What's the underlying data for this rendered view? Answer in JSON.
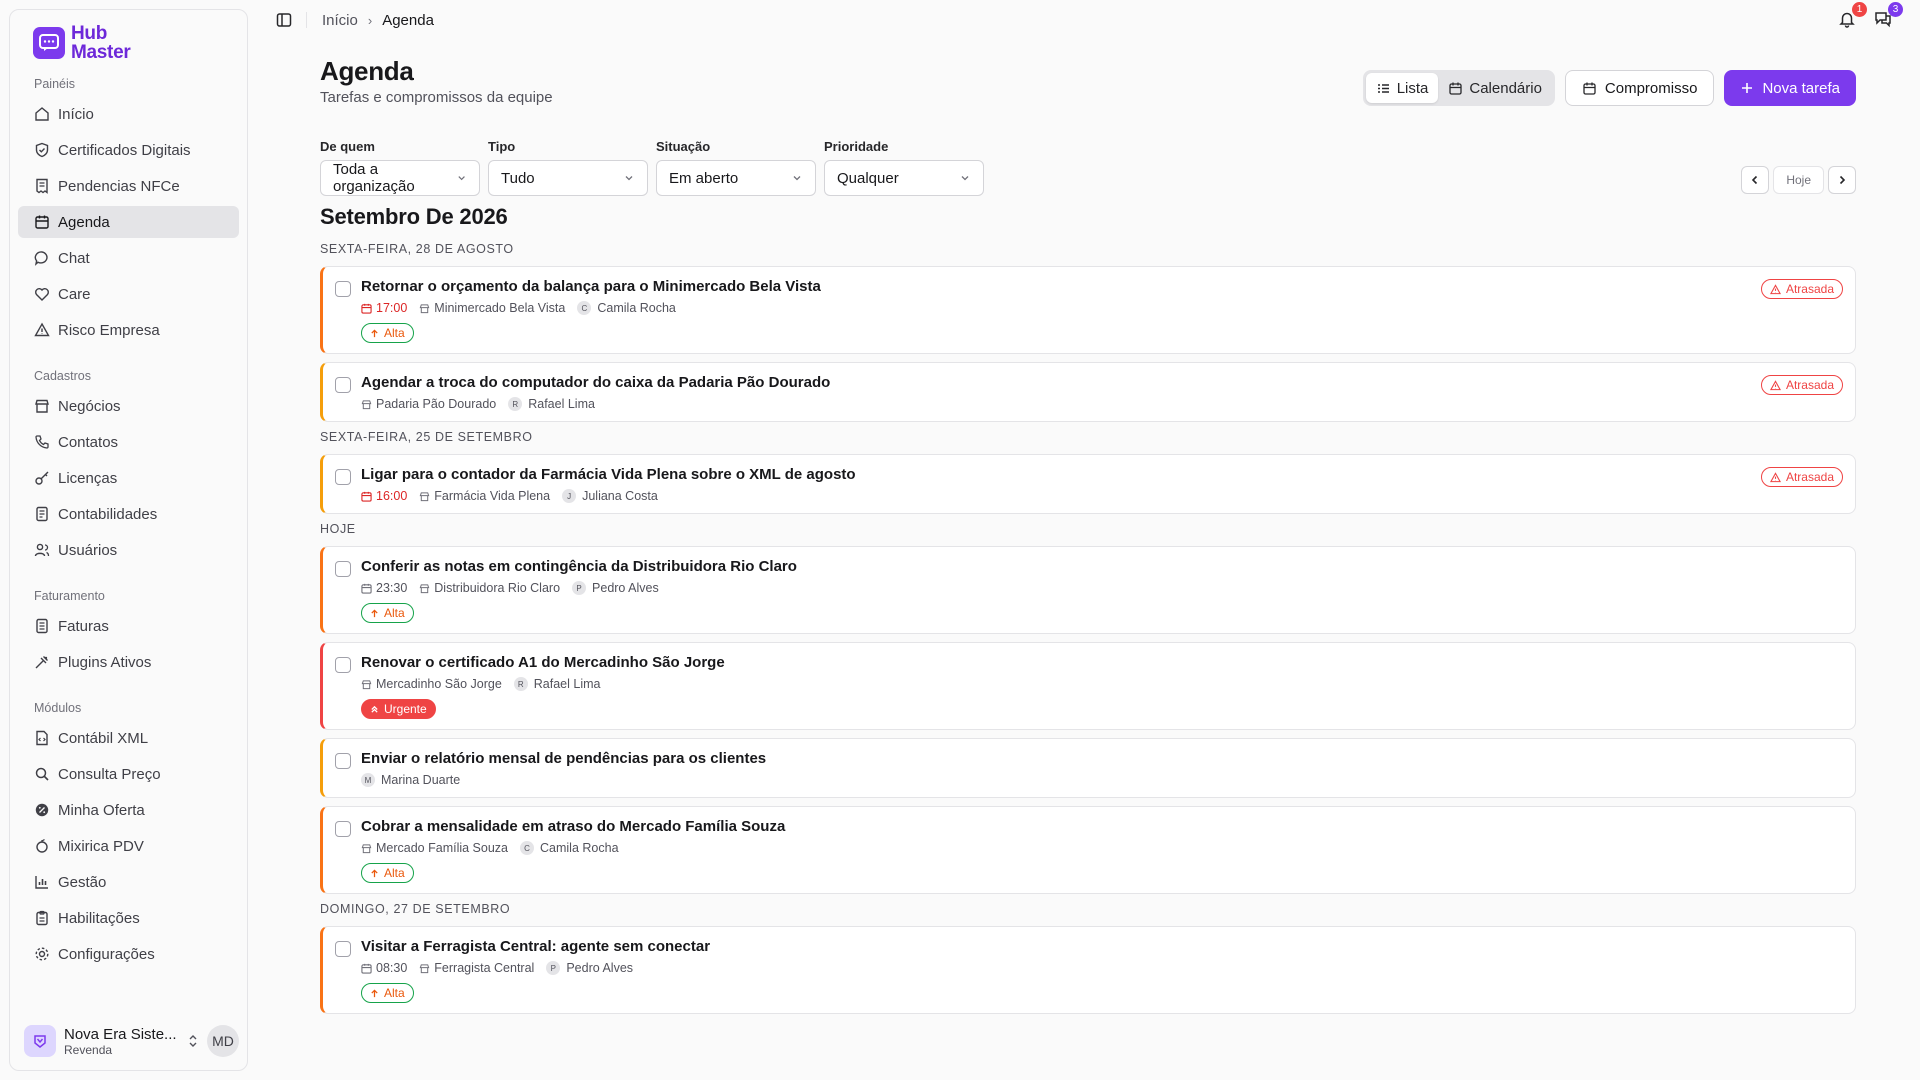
{
  "app": {
    "logo_line1": "Hub",
    "logo_line2": "Master"
  },
  "sidebar": {
    "groups": [
      {
        "label": "Painéis",
        "items": [
          {
            "label": "Início",
            "icon": "home-icon"
          },
          {
            "label": "Certificados Digitais",
            "icon": "shield-icon"
          },
          {
            "label": "Pendencias NFCe",
            "icon": "receipt-icon"
          },
          {
            "label": "Agenda",
            "icon": "calendar-icon",
            "active": true
          },
          {
            "label": "Chat",
            "icon": "chat-icon"
          },
          {
            "label": "Care",
            "icon": "heart-handshake-icon"
          },
          {
            "label": "Risco Empresa",
            "icon": "warning-icon"
          }
        ]
      },
      {
        "label": "Cadastros",
        "items": [
          {
            "label": "Negócios",
            "icon": "store-icon"
          },
          {
            "label": "Contatos",
            "icon": "phone-icon"
          },
          {
            "label": "Licenças",
            "icon": "key-icon"
          },
          {
            "label": "Contabilidades",
            "icon": "ledger-icon"
          },
          {
            "label": "Usuários",
            "icon": "users-icon"
          }
        ]
      },
      {
        "label": "Faturamento",
        "items": [
          {
            "label": "Faturas",
            "icon": "invoice-icon"
          },
          {
            "label": "Plugins Ativos",
            "icon": "plug-icon"
          }
        ]
      },
      {
        "label": "Módulos",
        "items": [
          {
            "label": "Contábil XML",
            "icon": "file-code-icon"
          },
          {
            "label": "Consulta Preço",
            "icon": "search-tag-icon"
          },
          {
            "label": "Minha Oferta",
            "icon": "badge-percent-icon"
          },
          {
            "label": "Mixirica PDV",
            "icon": "citrus-icon"
          },
          {
            "label": "Gestão",
            "icon": "bar-chart-icon"
          },
          {
            "label": "Habilitações",
            "icon": "clipboard-icon"
          },
          {
            "label": "Configurações",
            "icon": "gear-icon"
          }
        ]
      }
    ],
    "footer": {
      "org_name": "Nova Era Siste...",
      "org_role": "Revenda",
      "user_initials": "MD"
    }
  },
  "topbar": {
    "breadcrumb_home": "Início",
    "breadcrumb_current": "Agenda",
    "notifications_count": "1",
    "messages_count": "3"
  },
  "page": {
    "title": "Agenda",
    "subtitle": "Tarefas e compromissos da equipe",
    "view_list": "Lista",
    "view_calendar": "Calendário",
    "btn_appointment": "Compromisso",
    "btn_new_task": "Nova tarefa",
    "today_label": "Hoje",
    "month_title": "Setembro De 2026"
  },
  "filters": [
    {
      "label": "De quem",
      "value": "Toda a organização"
    },
    {
      "label": "Tipo",
      "value": "Tudo"
    },
    {
      "label": "Situação",
      "value": "Em aberto"
    },
    {
      "label": "Prioridade",
      "value": "Qualquer"
    }
  ],
  "labels": {
    "late": "Atrasada",
    "alta": "Alta",
    "urgente": "Urgente"
  },
  "colors": {
    "accent": "#7c3aed",
    "danger": "#ef4444",
    "orange": "#f97316",
    "amber": "#f59e0b",
    "badge_blue": "#7c3aed"
  },
  "days": [
    {
      "label": "SEXTA-FEIRA, 28 DE AGOSTO",
      "tasks": [
        {
          "title": "Retornar o orçamento da balança para o Minimercado Bela Vista",
          "time": "17:00",
          "late": true,
          "company": "Minimercado Bela Vista",
          "person": "Camila Rocha",
          "initial": "C",
          "priority": "alta",
          "border": "#f97316"
        },
        {
          "title": "Agendar a troca do computador do caixa da Padaria Pão Dourado",
          "time": "",
          "late": true,
          "company": "Padaria Pão Dourado",
          "person": "Rafael Lima",
          "initial": "R",
          "priority": "",
          "border": "#f59e0b"
        }
      ]
    },
    {
      "label": "SEXTA-FEIRA, 25 DE SETEMBRO",
      "tasks": [
        {
          "title": "Ligar para o contador da Farmácia Vida Plena sobre o XML de agosto",
          "time": "16:00",
          "late": true,
          "company": "Farmácia Vida Plena",
          "person": "Juliana Costa",
          "initial": "J",
          "priority": "",
          "border": "#f59e0b"
        }
      ]
    },
    {
      "label": "HOJE",
      "tasks": [
        {
          "title": "Conferir as notas em contingência da Distribuidora Rio Claro",
          "time": "23:30",
          "late": false,
          "company": "Distribuidora Rio Claro",
          "person": "Pedro Alves",
          "initial": "P",
          "priority": "alta",
          "border": "#f97316"
        },
        {
          "title": "Renovar o certificado A1 do Mercadinho São Jorge",
          "time": "",
          "late": false,
          "company": "Mercadinho São Jorge",
          "person": "Rafael Lima",
          "initial": "R",
          "priority": "urgente",
          "border": "#ef4444"
        },
        {
          "title": "Enviar o relatório mensal de pendências para os clientes",
          "time": "",
          "late": false,
          "company": "",
          "person": "Marina Duarte",
          "initial": "M",
          "priority": "",
          "border": "#f59e0b"
        },
        {
          "title": "Cobrar a mensalidade em atraso do Mercado Família Souza",
          "time": "",
          "late": false,
          "company": "Mercado Família Souza",
          "person": "Camila Rocha",
          "initial": "C",
          "priority": "alta",
          "border": "#f97316"
        }
      ]
    },
    {
      "label": "DOMINGO, 27 DE SETEMBRO",
      "tasks": [
        {
          "title": "Visitar a Ferragista Central: agente sem conectar",
          "time": "08:30",
          "late": false,
          "company": "Ferragista Central",
          "person": "Pedro Alves",
          "initial": "P",
          "priority": "alta",
          "border": "#f97316"
        }
      ]
    }
  ]
}
